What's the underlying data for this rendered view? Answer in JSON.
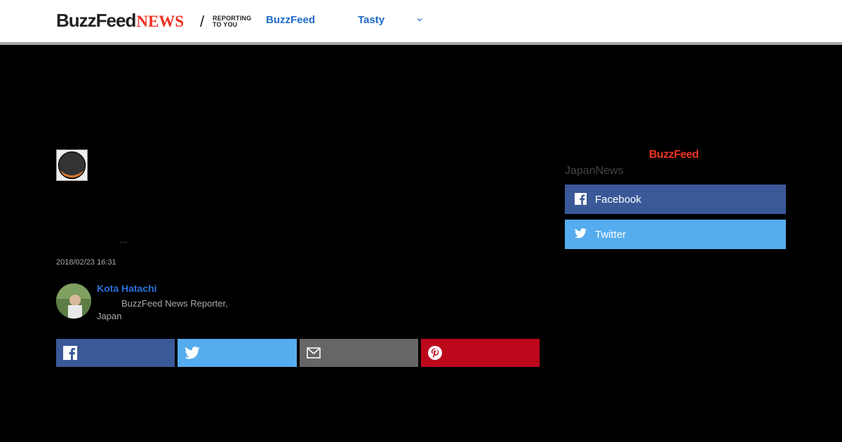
{
  "header": {
    "logo_main": "BuzzFeed",
    "logo_news": "NEWS",
    "tagline_1": "REPORTING",
    "tagline_2": "TO YOU",
    "nav": [
      {
        "label": "BuzzFeed"
      },
      {
        "label": "Tasty"
      }
    ]
  },
  "article": {
    "ellipsis": "…",
    "timestamp": "2018/02/23 16:31",
    "author": {
      "name": "Kota Hatachi",
      "role": "BuzzFeed News Reporter, Japan"
    },
    "share_buttons": [
      {
        "icon": "facebook-icon",
        "color": "#3b5998"
      },
      {
        "icon": "twitter-icon",
        "color": "#55acee"
      },
      {
        "icon": "mail-icon",
        "color": "#666666"
      },
      {
        "icon": "pinterest-icon",
        "color": "#bd081c"
      }
    ]
  },
  "sidebar": {
    "logo": "BuzzFeed",
    "caption": "JapanNews",
    "buttons": [
      {
        "label": "Facebook",
        "icon": "facebook-icon",
        "color": "#3b5998"
      },
      {
        "label": "Twitter",
        "icon": "twitter-icon",
        "color": "#55acee"
      }
    ]
  },
  "colors": {
    "accent_red": "#e32222",
    "link_blue": "#1e6bc8"
  }
}
